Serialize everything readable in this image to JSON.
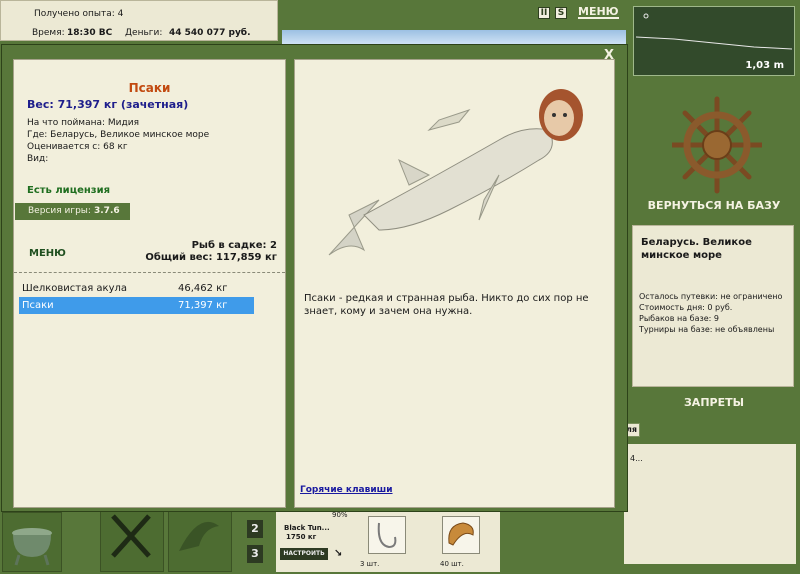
{
  "status": {
    "xp_label": "Получено опыта: 4",
    "time_label": "Время:",
    "time_value": "18:30 ВС",
    "money_label": "Деньги:",
    "money_value": "44 540 077 руб."
  },
  "toolbar": {
    "menu_label": "МЕНЮ",
    "pause_icon": "pause-icon",
    "sound_icon": "sound-icon"
  },
  "depth": {
    "value": "1,03 m"
  },
  "right": {
    "back_button": "ВЕРНУТЬСЯ НА БАЗУ",
    "location_title": "Беларусь. Великое минское море",
    "info": [
      "Осталось путевки: не ограничено",
      "Стоимость дня: 0 руб.",
      "Рыбаков на базе: 9",
      "Турниры на базе: не объявлены"
    ],
    "bans_button": "ЗАПРЕТЫ",
    "news_tab": "ля",
    "news_text": "4..."
  },
  "fish": {
    "name": "Псаки",
    "weight": "Вес: 71,397 кг (зачетная)",
    "bait": "На что поймана: Мидия",
    "where": "Где: Беларусь, Великое минское море",
    "valued": "Оценивается с: 68 кг",
    "kind": "Вид:",
    "license": "Есть лицензия",
    "version_label": "Версия игры:",
    "version_value": "3.7.6",
    "description": "Псаки - редкая и странная рыба. Никто до сих пор не знает, кому и зачем она нужна.",
    "hotkeys": "Горячие клавиши"
  },
  "cage": {
    "menu_label": "МЕНЮ",
    "fish_count": "Рыб в садке: 2",
    "total_weight": "Общий вес: 117,859 кг",
    "rows": [
      {
        "name": "Шелковистая акула",
        "weight": "46,462 кг"
      },
      {
        "name": "Псаки",
        "weight": "71,397 кг"
      }
    ]
  },
  "bottom": {
    "slot_2": "2",
    "slot_3": "3",
    "line_pct": "90%",
    "line_name": "Black Tun...",
    "line_kg": "1750 кг",
    "setup_button": "НАСТРОИТЬ",
    "hooks_count": "3 шт.",
    "bait_count": "40 шт."
  },
  "colors": {
    "bg_green": "#58773a",
    "panel": "#f2efdc",
    "title_orange": "#c24a10",
    "weight_blue": "#1e1e8c",
    "license_green": "#1f6e1f",
    "selected_row": "#3f9bea"
  }
}
